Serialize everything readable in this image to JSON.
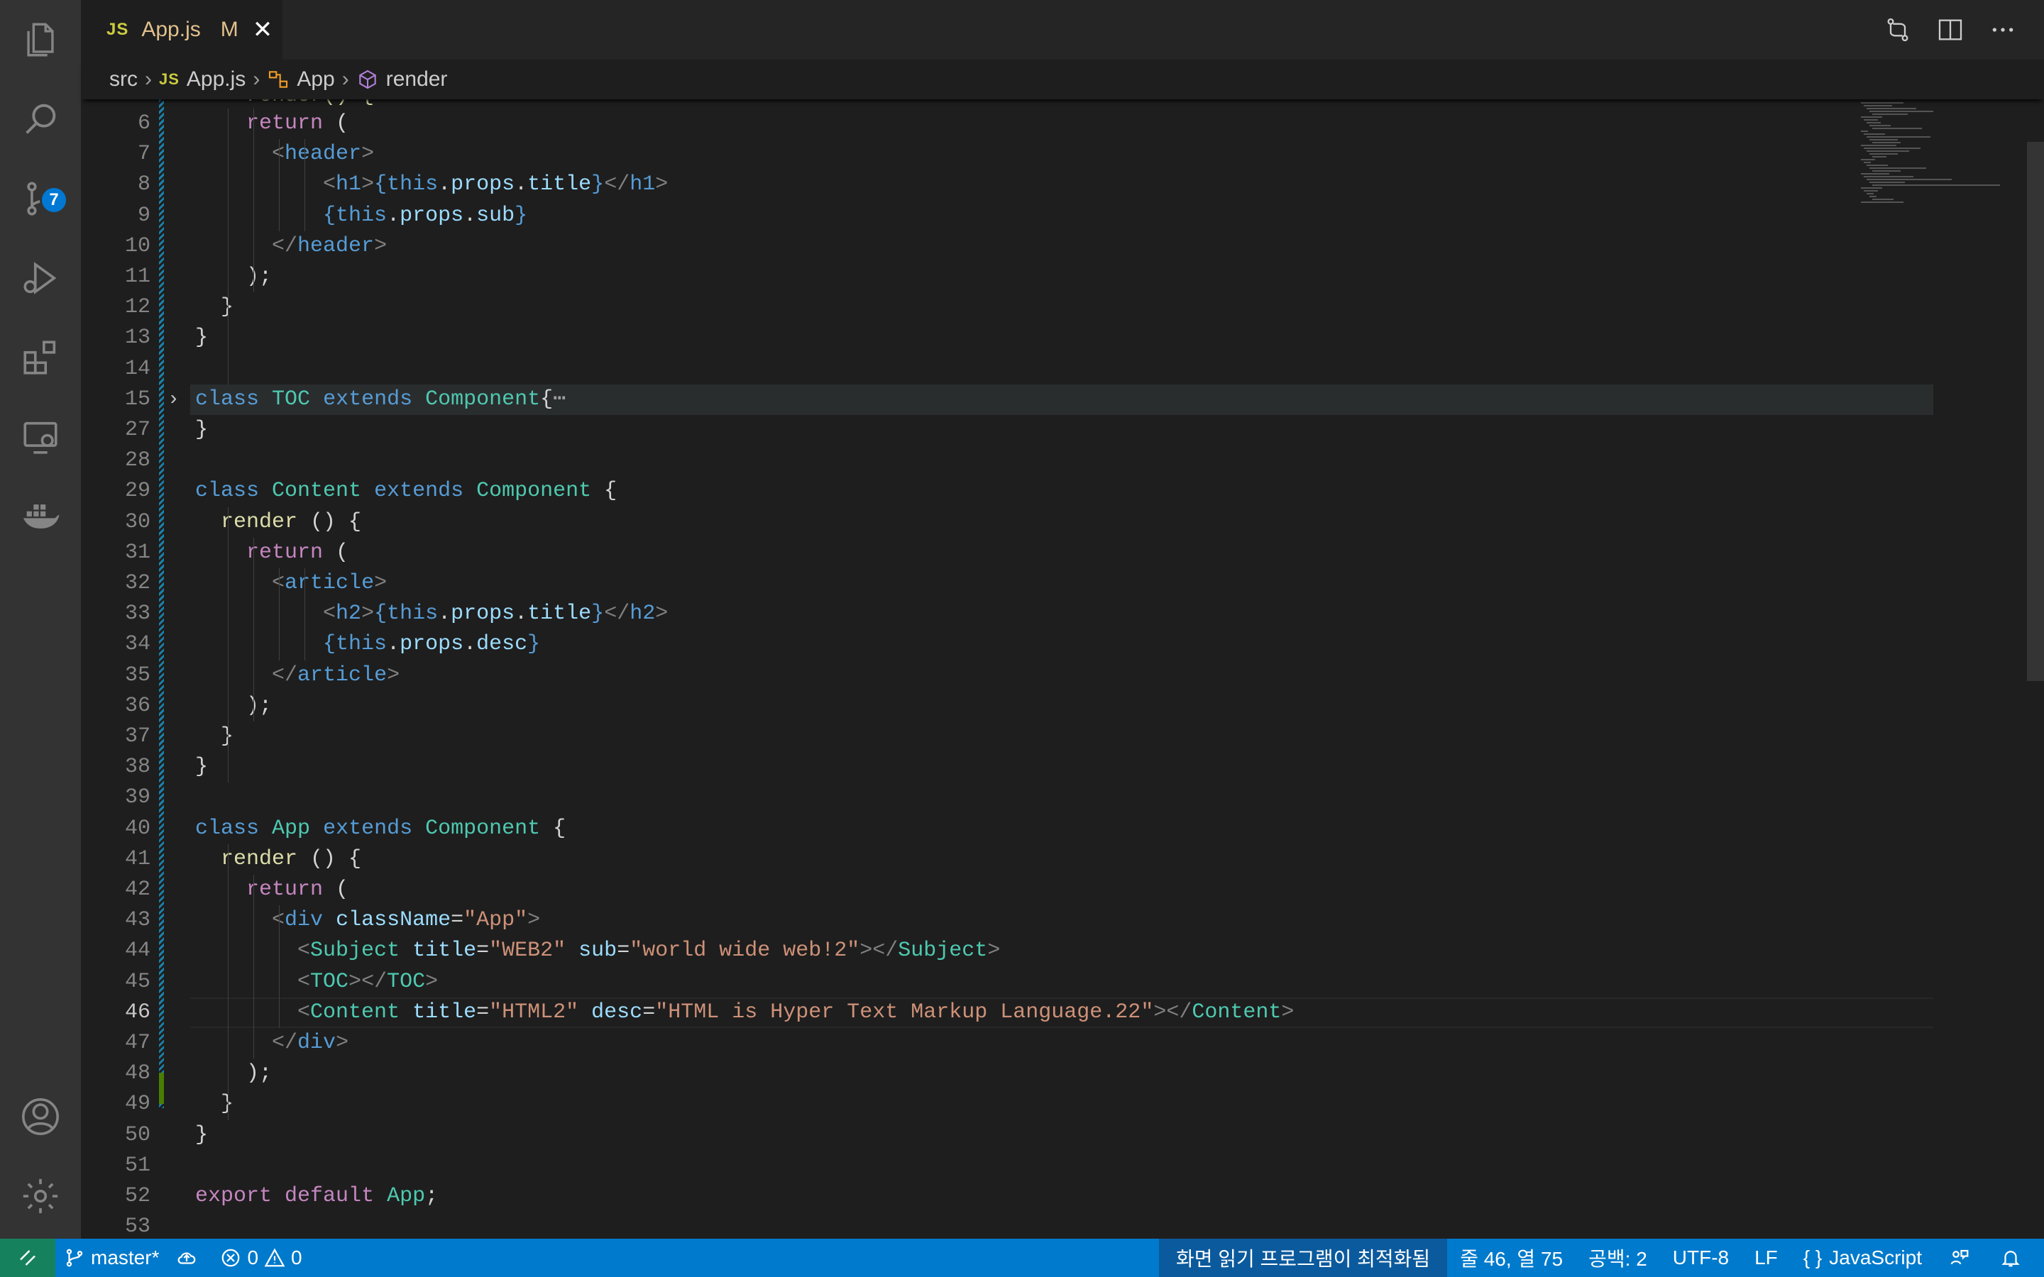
{
  "tab": {
    "lang_glyph": "JS",
    "title": "App.js",
    "modified_marker": "M",
    "close_glyph": "✕"
  },
  "breadcrumb": {
    "items": [
      "src",
      "App.js",
      "App",
      "render"
    ],
    "sep": "›"
  },
  "activity_bar": {
    "icons": [
      "explorer-icon",
      "search-icon",
      "source-control-icon",
      "run-debug-icon",
      "extensions-icon",
      "remote-explorer-icon",
      "docker-icon",
      "account-icon",
      "settings-gear-icon"
    ],
    "source_control_badge": "7"
  },
  "editor": {
    "current_line": "46",
    "folded_line": "15",
    "fold_ellipsis": "⋯",
    "partial_first_line": "    render() {",
    "lines": [
      {
        "n": "6",
        "segs": [
          [
            "pn",
            "    "
          ],
          [
            "kw",
            "return"
          ],
          [
            "pn",
            " ("
          ]
        ]
      },
      {
        "n": "7",
        "segs": [
          [
            "pn",
            "      "
          ],
          [
            "ang",
            "<"
          ],
          [
            "tag",
            "header"
          ],
          [
            "ang",
            ">"
          ]
        ]
      },
      {
        "n": "8",
        "segs": [
          [
            "pn",
            "          "
          ],
          [
            "ang",
            "<"
          ],
          [
            "tag",
            "h1"
          ],
          [
            "ang",
            ">"
          ],
          [
            "br",
            "{"
          ],
          [
            "st",
            "this"
          ],
          [
            "pn",
            "."
          ],
          [
            "var",
            "props"
          ],
          [
            "pn",
            "."
          ],
          [
            "var",
            "title"
          ],
          [
            "br",
            "}"
          ],
          [
            "ang",
            "</"
          ],
          [
            "tag",
            "h1"
          ],
          [
            "ang",
            ">"
          ]
        ]
      },
      {
        "n": "9",
        "segs": [
          [
            "pn",
            "          "
          ],
          [
            "br",
            "{"
          ],
          [
            "st",
            "this"
          ],
          [
            "pn",
            "."
          ],
          [
            "var",
            "props"
          ],
          [
            "pn",
            "."
          ],
          [
            "var",
            "sub"
          ],
          [
            "br",
            "}"
          ]
        ]
      },
      {
        "n": "10",
        "segs": [
          [
            "pn",
            "      "
          ],
          [
            "ang",
            "</"
          ],
          [
            "tag",
            "header"
          ],
          [
            "ang",
            ">"
          ]
        ]
      },
      {
        "n": "11",
        "segs": [
          [
            "pn",
            "    );"
          ]
        ]
      },
      {
        "n": "12",
        "segs": [
          [
            "pn",
            "  }"
          ]
        ]
      },
      {
        "n": "13",
        "segs": [
          [
            "pn",
            "}"
          ]
        ]
      },
      {
        "n": "14",
        "segs": []
      },
      {
        "n": "15",
        "segs": [
          [
            "st",
            "class"
          ],
          [
            "pn",
            " "
          ],
          [
            "cls",
            "TOC"
          ],
          [
            "pn",
            " "
          ],
          [
            "st",
            "extends"
          ],
          [
            "pn",
            " "
          ],
          [
            "cls",
            "Component"
          ],
          [
            "pn",
            "{"
          ]
        ]
      },
      {
        "n": "27",
        "segs": [
          [
            "pn",
            "}"
          ]
        ]
      },
      {
        "n": "28",
        "segs": []
      },
      {
        "n": "29",
        "segs": [
          [
            "st",
            "class"
          ],
          [
            "pn",
            " "
          ],
          [
            "cls",
            "Content"
          ],
          [
            "pn",
            " "
          ],
          [
            "st",
            "extends"
          ],
          [
            "pn",
            " "
          ],
          [
            "cls",
            "Component"
          ],
          [
            "pn",
            " {"
          ]
        ]
      },
      {
        "n": "30",
        "segs": [
          [
            "pn",
            "  "
          ],
          [
            "fn",
            "render"
          ],
          [
            "pn",
            " () {"
          ]
        ]
      },
      {
        "n": "31",
        "segs": [
          [
            "pn",
            "    "
          ],
          [
            "kw",
            "return"
          ],
          [
            "pn",
            " ("
          ]
        ]
      },
      {
        "n": "32",
        "segs": [
          [
            "pn",
            "      "
          ],
          [
            "ang",
            "<"
          ],
          [
            "tag",
            "article"
          ],
          [
            "ang",
            ">"
          ]
        ]
      },
      {
        "n": "33",
        "segs": [
          [
            "pn",
            "          "
          ],
          [
            "ang",
            "<"
          ],
          [
            "tag",
            "h2"
          ],
          [
            "ang",
            ">"
          ],
          [
            "br",
            "{"
          ],
          [
            "st",
            "this"
          ],
          [
            "pn",
            "."
          ],
          [
            "var",
            "props"
          ],
          [
            "pn",
            "."
          ],
          [
            "var",
            "title"
          ],
          [
            "br",
            "}"
          ],
          [
            "ang",
            "</"
          ],
          [
            "tag",
            "h2"
          ],
          [
            "ang",
            ">"
          ]
        ]
      },
      {
        "n": "34",
        "segs": [
          [
            "pn",
            "          "
          ],
          [
            "br",
            "{"
          ],
          [
            "st",
            "this"
          ],
          [
            "pn",
            "."
          ],
          [
            "var",
            "props"
          ],
          [
            "pn",
            "."
          ],
          [
            "var",
            "desc"
          ],
          [
            "br",
            "}"
          ]
        ]
      },
      {
        "n": "35",
        "segs": [
          [
            "pn",
            "      "
          ],
          [
            "ang",
            "</"
          ],
          [
            "tag",
            "article"
          ],
          [
            "ang",
            ">"
          ]
        ]
      },
      {
        "n": "36",
        "segs": [
          [
            "pn",
            "    );"
          ]
        ]
      },
      {
        "n": "37",
        "segs": [
          [
            "pn",
            "  }"
          ]
        ]
      },
      {
        "n": "38",
        "segs": [
          [
            "pn",
            "}"
          ]
        ]
      },
      {
        "n": "39",
        "segs": []
      },
      {
        "n": "40",
        "segs": [
          [
            "st",
            "class"
          ],
          [
            "pn",
            " "
          ],
          [
            "cls",
            "App"
          ],
          [
            "pn",
            " "
          ],
          [
            "st",
            "extends"
          ],
          [
            "pn",
            " "
          ],
          [
            "cls",
            "Component"
          ],
          [
            "pn",
            " {"
          ]
        ]
      },
      {
        "n": "41",
        "segs": [
          [
            "pn",
            "  "
          ],
          [
            "fn",
            "render"
          ],
          [
            "pn",
            " () {"
          ]
        ]
      },
      {
        "n": "42",
        "segs": [
          [
            "pn",
            "    "
          ],
          [
            "kw",
            "return"
          ],
          [
            "pn",
            " ("
          ]
        ]
      },
      {
        "n": "43",
        "segs": [
          [
            "pn",
            "      "
          ],
          [
            "ang",
            "<"
          ],
          [
            "tag",
            "div"
          ],
          [
            "pn",
            " "
          ],
          [
            "attr",
            "className"
          ],
          [
            "pn",
            "="
          ],
          [
            "str",
            "\"App\""
          ],
          [
            "ang",
            ">"
          ]
        ]
      },
      {
        "n": "44",
        "segs": [
          [
            "pn",
            "        "
          ],
          [
            "ang",
            "<"
          ],
          [
            "jsx",
            "Subject"
          ],
          [
            "pn",
            " "
          ],
          [
            "attr",
            "title"
          ],
          [
            "pn",
            "="
          ],
          [
            "str",
            "\"WEB2\""
          ],
          [
            "pn",
            " "
          ],
          [
            "attr",
            "sub"
          ],
          [
            "pn",
            "="
          ],
          [
            "str",
            "\"world wide web!2\""
          ],
          [
            "ang",
            "></"
          ],
          [
            "jsx",
            "Subject"
          ],
          [
            "ang",
            ">"
          ]
        ]
      },
      {
        "n": "45",
        "segs": [
          [
            "pn",
            "        "
          ],
          [
            "ang",
            "<"
          ],
          [
            "jsx",
            "TOC"
          ],
          [
            "ang",
            "></"
          ],
          [
            "jsx",
            "TOC"
          ],
          [
            "ang",
            ">"
          ]
        ]
      },
      {
        "n": "46",
        "segs": [
          [
            "pn",
            "        "
          ],
          [
            "ang",
            "<"
          ],
          [
            "jsx",
            "Content"
          ],
          [
            "pn",
            " "
          ],
          [
            "attr",
            "title"
          ],
          [
            "pn",
            "="
          ],
          [
            "str",
            "\"HTML2\""
          ],
          [
            "pn",
            " "
          ],
          [
            "attr",
            "desc"
          ],
          [
            "pn",
            "="
          ],
          [
            "str",
            "\"HTML is Hyper Text Markup Language.22\""
          ],
          [
            "ang",
            "></"
          ],
          [
            "jsx",
            "Content"
          ],
          [
            "ang",
            ">"
          ]
        ]
      },
      {
        "n": "47",
        "segs": [
          [
            "pn",
            "      "
          ],
          [
            "ang",
            "</"
          ],
          [
            "tag",
            "div"
          ],
          [
            "ang",
            ">"
          ]
        ]
      },
      {
        "n": "48",
        "segs": [
          [
            "pn",
            "    );"
          ]
        ]
      },
      {
        "n": "49",
        "segs": [
          [
            "pn",
            "  }"
          ]
        ]
      },
      {
        "n": "50",
        "segs": [
          [
            "pn",
            "}"
          ]
        ]
      },
      {
        "n": "51",
        "segs": []
      },
      {
        "n": "52",
        "segs": [
          [
            "kw",
            "export"
          ],
          [
            "pn",
            " "
          ],
          [
            "kw",
            "default"
          ],
          [
            "pn",
            " "
          ],
          [
            "cls",
            "App"
          ],
          [
            "pn",
            ";"
          ]
        ]
      },
      {
        "n": "53",
        "segs": []
      }
    ]
  },
  "status_bar": {
    "branch": "master*",
    "errors": "0",
    "warnings": "0",
    "screen_reader": "화면 읽기 프로그램이 최적화됨",
    "cursor_position": "줄 46, 열 75",
    "indentation": "공백: 2",
    "encoding": "UTF-8",
    "eol": "LF",
    "language_glyph": "{ }",
    "language": "JavaScript"
  },
  "colors": {
    "status_bar": "#007acc",
    "remote": "#16825d",
    "activity_bar": "#333333",
    "editor_bg": "#1e1e1e",
    "modified_tab": "#e2c08d"
  }
}
